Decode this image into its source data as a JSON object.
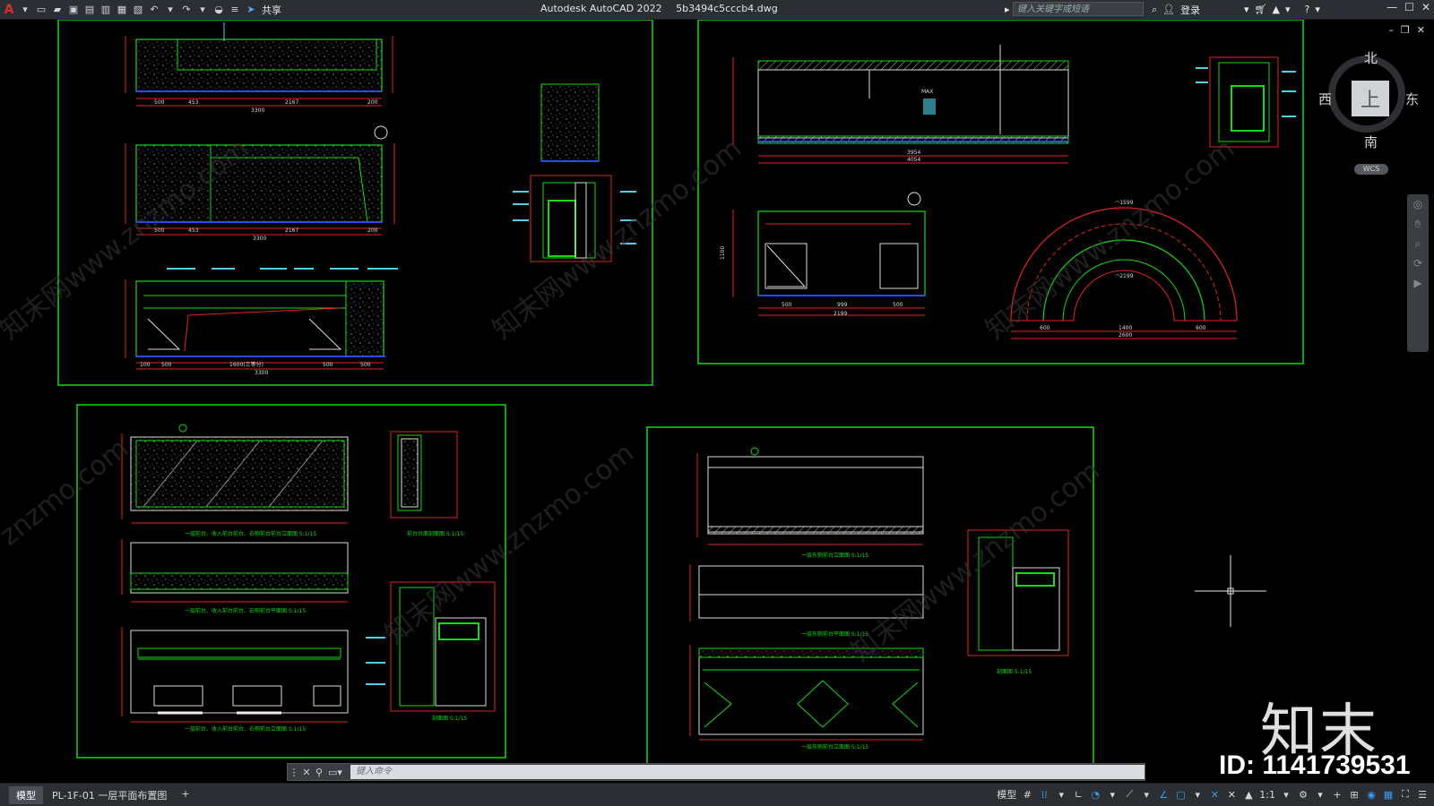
{
  "app": {
    "title": "Autodesk AutoCAD 2022",
    "filename": "5b3494c5cccb4.dwg"
  },
  "quick_access": {
    "share_label": "共享"
  },
  "search": {
    "placeholder": "键入关键字或短语"
  },
  "account": {
    "login_label": "登录"
  },
  "viewcube": {
    "north": "北",
    "south": "南",
    "east": "东",
    "west": "西",
    "face": "上",
    "wcs": "WCS"
  },
  "drawing_texts": {
    "dim_3300_a": "3300",
    "dim_3300_b": "3300",
    "dim_3300_c": "3300",
    "dim_500_a": "500",
    "dim_453_a": "453",
    "dim_2167_a": "2167",
    "dim_200_a": "200",
    "dim_500_b": "500",
    "dim_453_b": "453",
    "dim_2167_b": "2167",
    "dim_200_b": "200",
    "dim_1600": "1600(三等分)",
    "dim_100": "100",
    "dim_500_c": "500",
    "dim_500_d": "500",
    "dim_500_e": "500",
    "dim_3954": "3954",
    "dim_4054": "4054",
    "dim_1100_a": "1100",
    "dim_2199": "2199",
    "dim_999": "999",
    "dim_500_f": "500",
    "dim_500_g": "500",
    "dim_1100_b": "1100",
    "dim_1400": "1400",
    "dim_2600": "2600",
    "dim_600_a": "600",
    "dim_600_b": "600",
    "dim_r1599": "◠1599",
    "dim_r2199": "◠2199",
    "max_label": "MAX",
    "caption_1": "一层前台、收入前台前台、右侧前台前台立面图  S:1/15",
    "caption_2": "前台台面剖面图  S:1/15",
    "caption_3": "一层前台、收入前台前台、右侧前台平面图  S:1/15",
    "caption_4": "一层前台、收入前台前台、右侧前台立面图  S:1/15",
    "caption_5": "剖面图  S:1/15",
    "caption_6": "一层东侧前台立面图  S:1/15",
    "caption_7": "一层东侧前台平面图  S:1/15",
    "caption_8": "一层东侧前台立面图  S:1/15",
    "caption_9": "剖面图  S:1/15"
  },
  "command_line": {
    "placeholder": "键入命令"
  },
  "status_bar": {
    "tabs": [
      "模型",
      "PL-1F-01 一层平面布置图"
    ],
    "add_tab": "+",
    "model_label": "模型",
    "scale": "1:1"
  },
  "watermark": {
    "logo": "知末",
    "id": "ID: 1141739531",
    "site": "znzmo.com",
    "site_cn": "知末网www.znzmo.com"
  },
  "colors": {
    "green": "#17d717",
    "red": "#e02424",
    "blue": "#2a4cff",
    "cyan": "#4fd1e8",
    "titlebar": "#2b2e33"
  }
}
